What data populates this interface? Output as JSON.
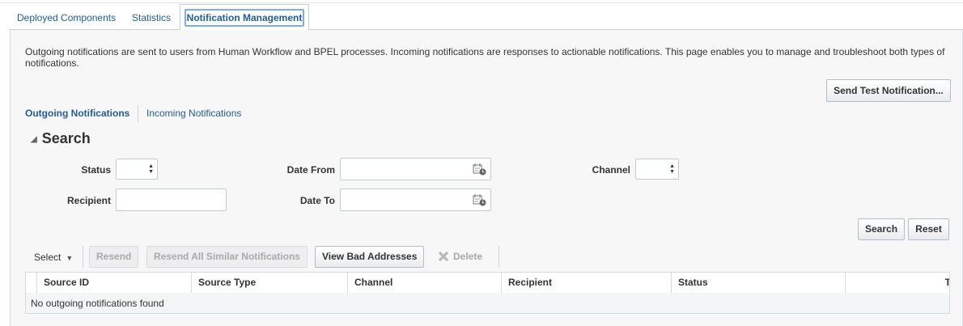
{
  "tabs": {
    "deployed_components": "Deployed Components",
    "statistics": "Statistics",
    "notification_management": "Notification Management"
  },
  "description": "Outgoing notifications are sent to users from Human Workflow and BPEL processes. Incoming notifications are responses to actionable notifications. This page enables you to manage and troubleshoot both types of notifications.",
  "send_test_button": "Send Test Notification...",
  "subtabs": {
    "outgoing": "Outgoing Notifications",
    "incoming": "Incoming Notifications"
  },
  "search": {
    "title": "Search",
    "status_label": "Status",
    "status_value": "",
    "recipient_label": "Recipient",
    "recipient_value": "",
    "date_from_label": "Date From",
    "date_from_value": "",
    "date_to_label": "Date To",
    "date_to_value": "",
    "channel_label": "Channel",
    "channel_value": "",
    "search_button": "Search",
    "reset_button": "Reset"
  },
  "toolbar": {
    "select_menu": "Select",
    "resend": "Resend",
    "resend_all": "Resend All Similar Notifications",
    "view_bad_addresses": "View Bad Addresses",
    "delete": "Delete"
  },
  "table": {
    "columns": [
      "Source ID",
      "Source Type",
      "Channel",
      "Recipient",
      "Status",
      "T"
    ],
    "empty_message": "No outgoing notifications found"
  },
  "colors": {
    "link": "#1f5c99",
    "focus_ring": "#7aaee6",
    "panel_bg": "#f7f7f7",
    "disabled_text": "#a9a9a9"
  }
}
